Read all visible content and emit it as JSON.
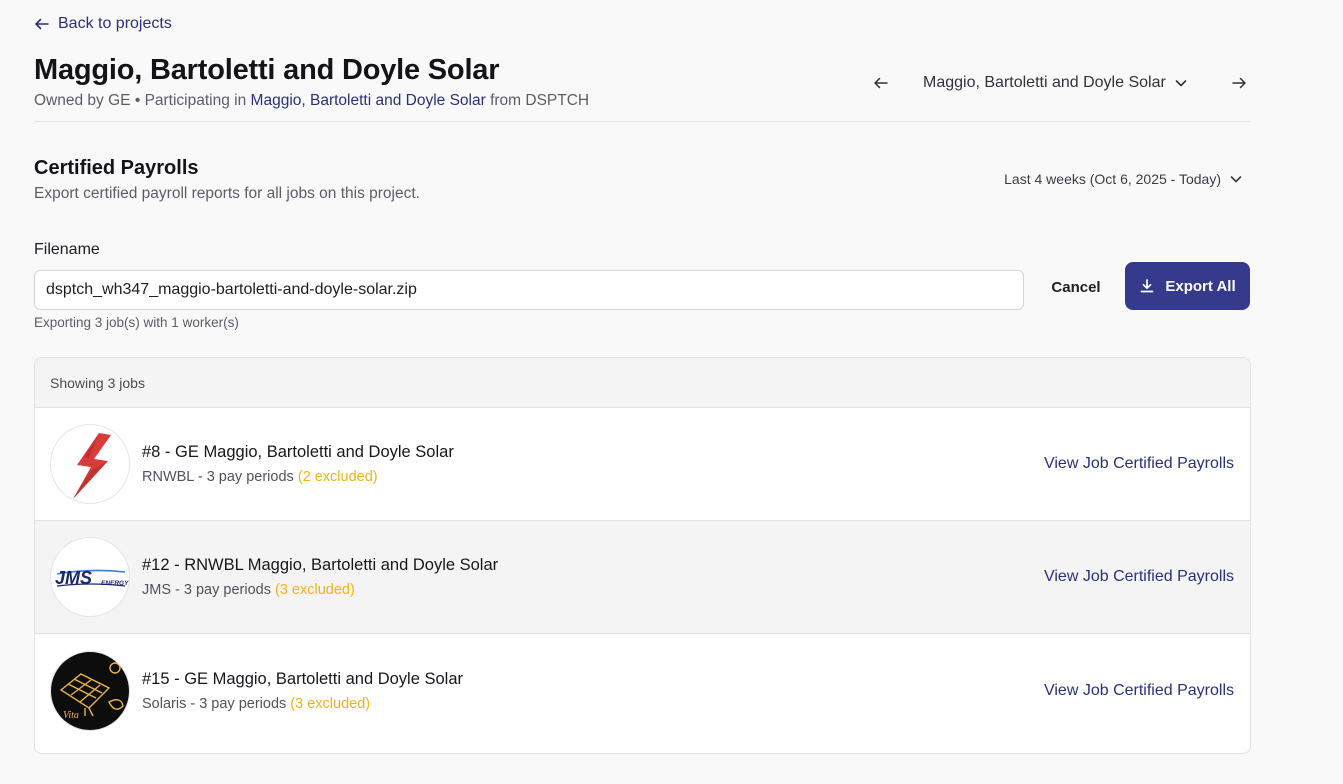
{
  "nav": {
    "back_label": "Back to projects"
  },
  "project": {
    "title": "Maggio, Bartoletti and Doyle Solar",
    "owned_prefix": "Owned by GE",
    "separator": "•",
    "participating_prefix": "Participating in",
    "participating_link": "Maggio, Bartoletti and Doyle Solar",
    "from_text": "from DSPTCH",
    "selector_value": "Maggio, Bartoletti and Doyle Solar"
  },
  "payrolls": {
    "title": "Certified Payrolls",
    "description": "Export certified payroll reports for all jobs on this project.",
    "date_range": "Last 4 weeks (Oct 6, 2025 - Today)",
    "filename_label": "Filename",
    "filename_value": "dsptch_wh347_maggio-bartoletti-and-doyle-solar.zip",
    "export_note": "Exporting 3 job(s) with 1 worker(s)",
    "cancel_label": "Cancel",
    "export_label": "Export All"
  },
  "jobs": {
    "header": "Showing 3 jobs",
    "items": [
      {
        "title": "#8 - GE Maggio, Bartoletti and Doyle Solar",
        "meta": "RNWBL - 3 pay periods",
        "excluded": "(2 excluded)",
        "link": "View Job Certified Payrolls",
        "logo": "lightning-bolt-logo"
      },
      {
        "title": "#12 - RNWBL Maggio, Bartoletti and Doyle Solar",
        "meta": "JMS - 3 pay periods",
        "excluded": "(3 excluded)",
        "link": "View Job Certified Payrolls",
        "logo": "jms-energy-logo",
        "logo_text": "JMS",
        "logo_subtext": "ENERGY"
      },
      {
        "title": "#15 - GE Maggio, Bartoletti and Doyle Solar",
        "meta": "Solaris - 3 pay periods",
        "excluded": "(3 excluded)",
        "link": "View Job Certified Payrolls",
        "logo": "vita-solar-panel-logo",
        "logo_text": "Vita"
      }
    ]
  },
  "colors": {
    "accent": "#353a8c",
    "link": "#2b2f7a",
    "excluded": "#f5b11a"
  }
}
